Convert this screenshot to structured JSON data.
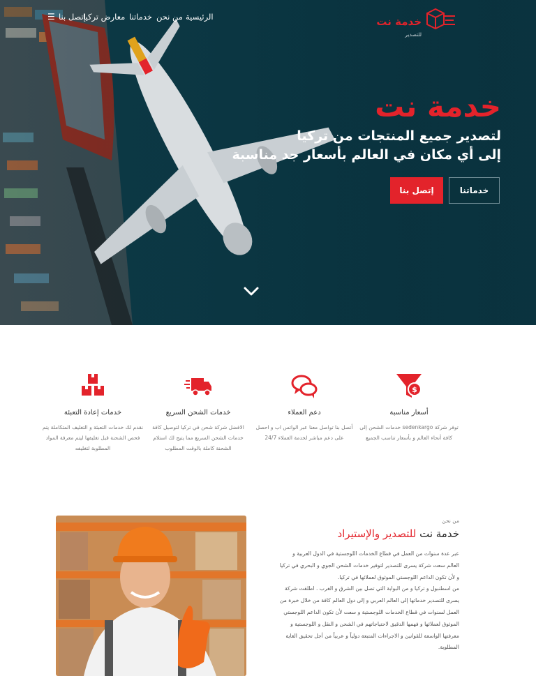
{
  "nav": {
    "items": [
      "الرئيسية",
      "من نحن",
      "خدماتنا",
      "معارض تركيا",
      "إتصل بنا"
    ],
    "menu_icon": "menu-icon"
  },
  "logo": {
    "title": "خدمة نت",
    "subtitle": "للتصدير",
    "icon": "box-shipping-icon"
  },
  "hero": {
    "title": "خدمة نت",
    "line1": "لتصدير جميع المنتجات من تركيا",
    "line2": "إلى أي مكان في العالم بأسعار جد مناسبة",
    "btn_services": "خدماتنا",
    "btn_contact": "إتصل بنا",
    "scroll_icon": "chevron-down-icon"
  },
  "features": [
    {
      "icon": "funnel-money-icon",
      "title": "أسعار مناسبة",
      "desc": "توفر شركة sedenkargo خدمات الشحن إلى كافة أنحاء العالم و بأسعار تناسب الجميع"
    },
    {
      "icon": "chat-bubbles-icon",
      "title": "دعم العملاء",
      "desc": "أتصل بنا تواصل معنا عبر الواتس اب و احصل على دعم مباشر لخدمة العملاء 24/7"
    },
    {
      "icon": "delivery-truck-icon",
      "title": "خدمات الشحن السريع",
      "desc": "الافضل شركة شحن في تركيا لتوصيل كافة خدمات الشحن السريع مما يتيح لك استلام الشحنة كاملة بالوقت المطلوب"
    },
    {
      "icon": "boxes-icon",
      "title": "خدمات إعادة التعبئة",
      "desc": "نقدم لك خدمات التعبئة و التغليف المتكاملة يتم فحص الشحنة قبل تغليفها ليتم معرفة المواد المطلوبة لتغليفه"
    }
  ],
  "about": {
    "label": "من نحن",
    "heading_dark": "خدمة نت",
    "heading_red": "للتصدير والإستيراد",
    "paragraphs": [
      "عبر عدة سنوات من العمل في قطاع الخدمات اللوجستية في الدول العربية و العالم سعت شركة يسرى للتصدير لتوفير خدمات الشحن الجوي و البحري في تركيا و لأن تكون الداعم اللوجستي الموثوق لعملائها في تركيا.",
      "من اسطنبول و تركيا و من البوابة التي تصل بين الشرق و الغرب . اطلقت شركة يسرى للتصدير خدماتها إلى العالم العربي و إلى دول العالم كافة من خلال خبرة من العمل لسنوات في قطاع الخدمات اللوجستية و سعت لأن تكون الداعم اللوجستي الموثوق لعملائها و فهمها الدقيق لاحتياجاتهم في الشحن و النقل و اللوجستية و معرفتها الواسعة للقوانين و الاجراءات المتبعة دولياً و عربياً من أجل تحقيق الغاية المطلوبة."
    ]
  },
  "colors": {
    "accent": "#e3232b",
    "hero_bg": "#0b3642"
  }
}
